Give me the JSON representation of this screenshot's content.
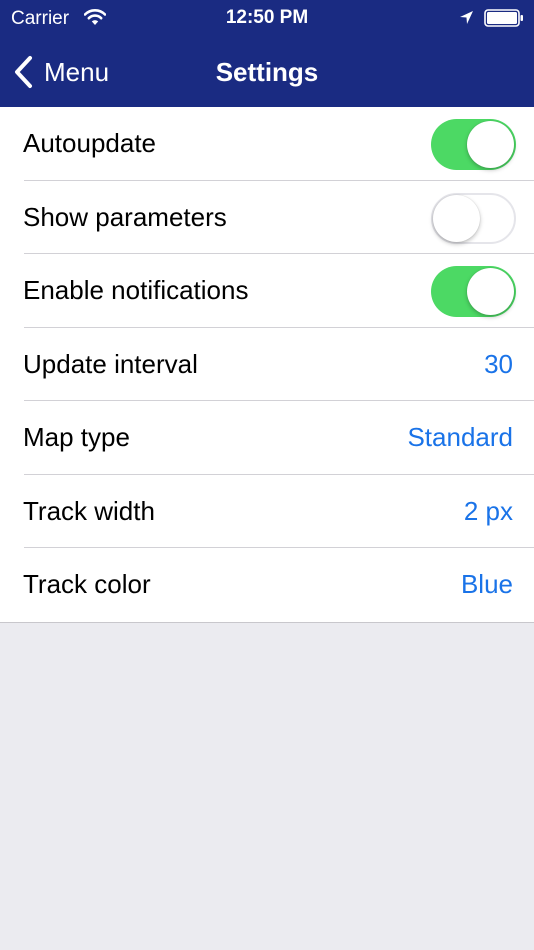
{
  "status_bar": {
    "carrier": "Carrier",
    "time": "12:50 PM",
    "icons": [
      "wifi-icon",
      "location-arrow-icon",
      "battery-icon"
    ]
  },
  "nav": {
    "back_label": "Menu",
    "back_icon": "chevron-left-icon",
    "title": "Settings"
  },
  "colors": {
    "nav_background": "#1a2b82",
    "accent": "#1a73e8",
    "toggle_on": "#4cd964",
    "page_background": "#ebebf0"
  },
  "settings": {
    "autoupdate": {
      "label": "Autoupdate",
      "enabled": true
    },
    "show_parameters": {
      "label": "Show parameters",
      "enabled": false
    },
    "enable_notifications": {
      "label": "Enable notifications",
      "enabled": true
    },
    "update_interval": {
      "label": "Update interval",
      "value": "30"
    },
    "map_type": {
      "label": "Map type",
      "value": "Standard"
    },
    "track_width": {
      "label": "Track width",
      "value": "2 px"
    },
    "track_color": {
      "label": "Track color",
      "value": "Blue"
    }
  }
}
